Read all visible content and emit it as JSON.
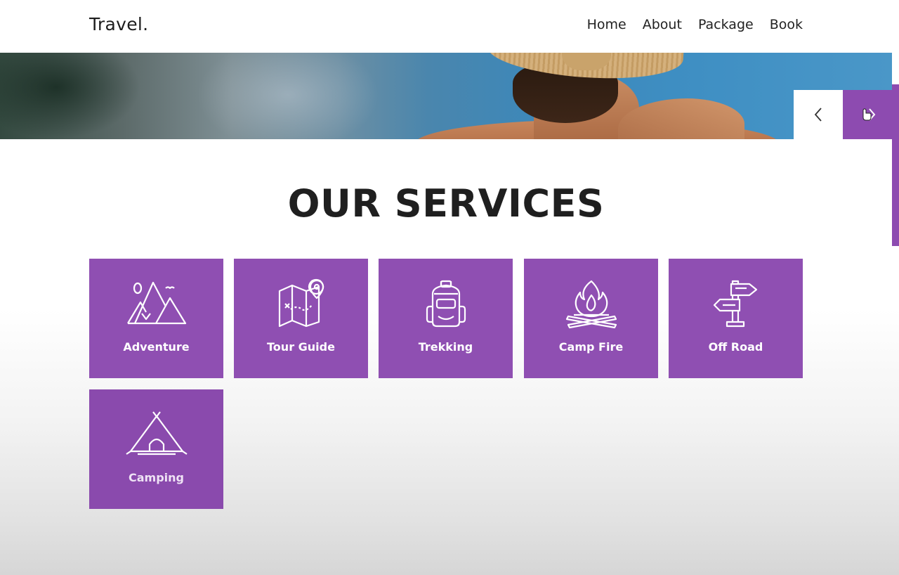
{
  "header": {
    "logo": "Travel.",
    "nav": [
      "Home",
      "About",
      "Package",
      "Book"
    ]
  },
  "hero": {
    "prev_icon": "chevron-left-icon",
    "next_icon": "chevron-right-icon"
  },
  "services": {
    "title": "OUR SERVICES",
    "items": [
      {
        "label": "Adventure",
        "icon": "mountains-icon"
      },
      {
        "label": "Tour Guide",
        "icon": "map-pin-icon"
      },
      {
        "label": "Trekking",
        "icon": "backpack-icon"
      },
      {
        "label": "Camp Fire",
        "icon": "campfire-icon"
      },
      {
        "label": "Off Road",
        "icon": "signpost-icon"
      },
      {
        "label": "Camping",
        "icon": "tent-icon"
      }
    ]
  },
  "colors": {
    "accent": "#8f4fb2",
    "title": "#1f1f1f",
    "card_text": "#ffffff"
  }
}
